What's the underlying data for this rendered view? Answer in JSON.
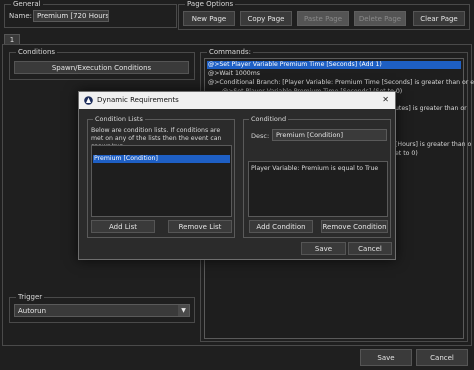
{
  "general": {
    "legend": "General",
    "name_label": "Name:",
    "name_value": "Premium [720 Hours]"
  },
  "page_options": {
    "legend": "Page Options",
    "new_page": "New Page",
    "copy_page": "Copy Page",
    "paste_page": "Paste Page",
    "delete_page": "Delete Page",
    "clear_page": "Clear Page"
  },
  "tabs": [
    "1"
  ],
  "conditions": {
    "legend": "Conditions",
    "spawn_button": "Spawn/Execution Conditions"
  },
  "commands": {
    "legend": "Commands:",
    "lines": [
      "@>Set Player Variable Premium Time [Seconds] (Add 1)",
      "@>Wait 1000ms",
      "@>Conditional Branch: [Player Variable: Premium Time [Seconds] is greater than or equ",
      "@>Set Player Variable Premium Time [Seconds] (Set to 0)"
    ],
    "partial_lines": [
      "utes] is greater than or",
      "",
      "[Hours] is greater than o",
      "et to 0)"
    ]
  },
  "trigger": {
    "legend": "Trigger",
    "value": "Autorun"
  },
  "footer": {
    "save": "Save",
    "cancel": "Cancel"
  },
  "dialog": {
    "title": "Dynamic Requirements",
    "close_glyph": "✕",
    "condition_lists": {
      "legend": "Condition Lists",
      "description": "Below are condition lists. If conditions are met on any of the lists then the event can spawn/run.",
      "items": [
        "Premium [Condition]"
      ],
      "add_list": "Add List",
      "remove_list": "Remove List"
    },
    "conditions": {
      "legend": "Conditiond",
      "desc_label": "Desc:",
      "desc_value": "Premium [Condition]",
      "items": [
        "Player Variable: Premium is equal to True"
      ],
      "add_condition": "Add Condition",
      "remove_condition": "Remove Condition"
    },
    "save": "Save",
    "cancel": "Cancel"
  },
  "colors": {
    "selection": "#1e5fc4",
    "background": "#1f1f1f",
    "dialog_title": "#f0f0f0"
  }
}
